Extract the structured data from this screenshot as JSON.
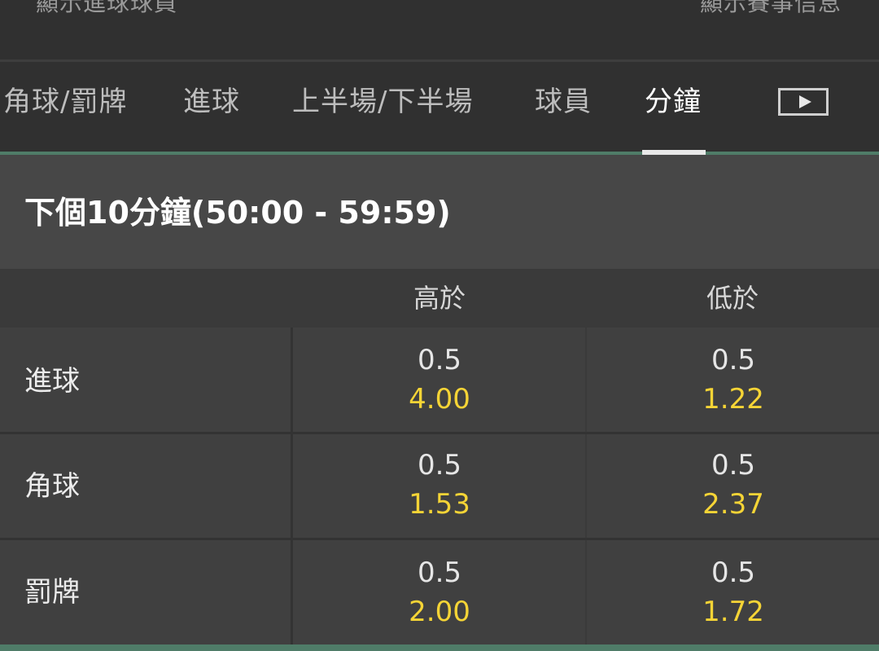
{
  "top": {
    "left_link": "顯示進球球員",
    "right_link": "顯示賽事信息"
  },
  "tabs": [
    {
      "label": "角球/罰牌",
      "active": false
    },
    {
      "label": "進球",
      "active": false
    },
    {
      "label": "上半場/下半場",
      "active": false
    },
    {
      "label": "球員",
      "active": false
    },
    {
      "label": "分鐘",
      "active": true
    }
  ],
  "play_icon": "play-video-icon",
  "section": {
    "title": "下個10分鐘(50:00 - 59:59)"
  },
  "columns": {
    "over": "高於",
    "under": "低於"
  },
  "rows": [
    {
      "label": "進球",
      "over_line": "0.5",
      "over_odds": "4.00",
      "under_line": "0.5",
      "under_odds": "1.22"
    },
    {
      "label": "角球",
      "over_line": "0.5",
      "over_odds": "1.53",
      "under_line": "0.5",
      "under_odds": "2.37"
    },
    {
      "label": "罰牌",
      "over_line": "0.5",
      "over_odds": "2.00",
      "under_line": "0.5",
      "under_odds": "1.72"
    }
  ],
  "colors": {
    "accent_green": "#4f7c68",
    "odds_yellow": "#f5d436"
  }
}
